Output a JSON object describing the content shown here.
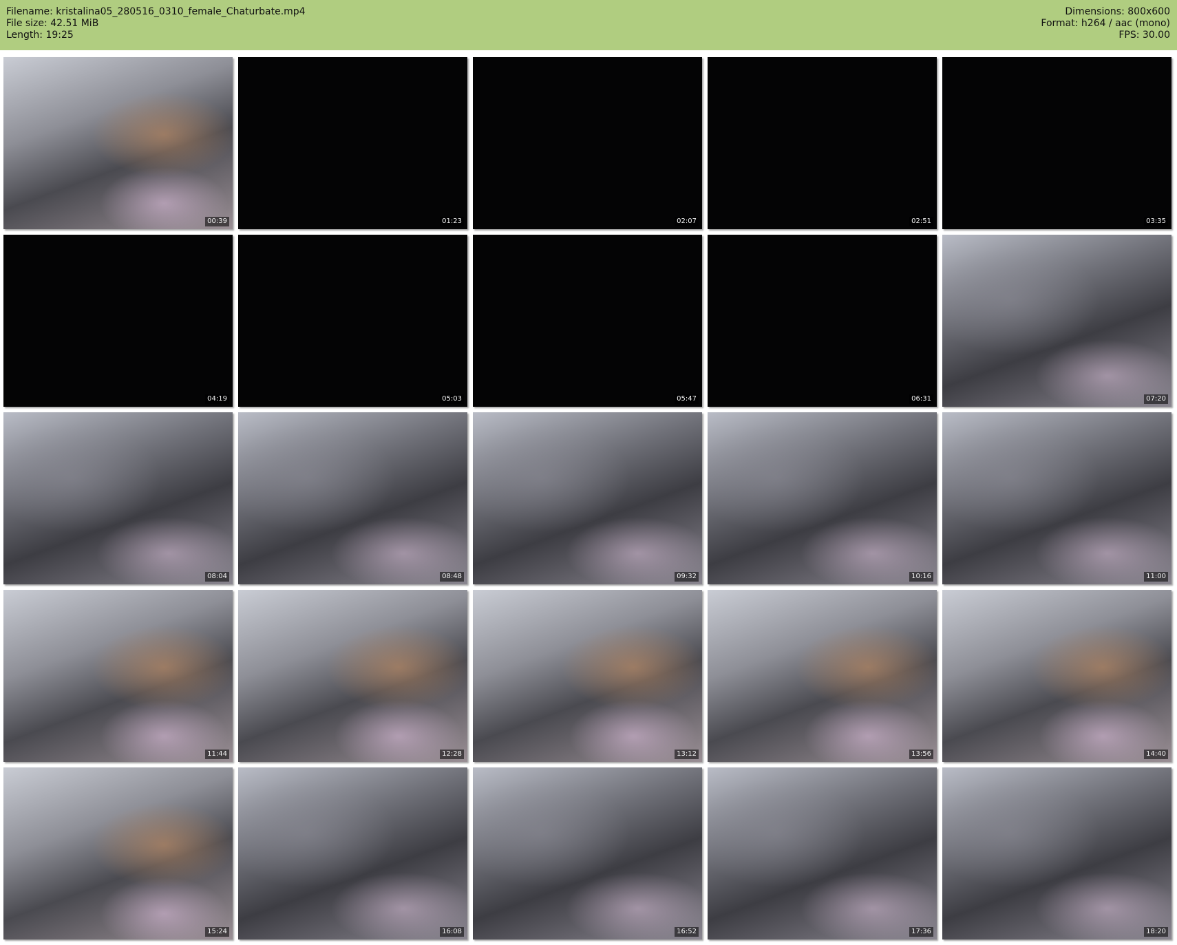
{
  "header": {
    "filename_line": "Filename: kristalina05_280516_0310_female_Chaturbate.mp4",
    "filesize_line": "File size: 42.51 MiB",
    "length_line": "Length: 19:25",
    "dimensions_line": "Dimensions: 800x600",
    "format_line": "Format: h264 / aac (mono)",
    "fps_line": "FPS: 30.00"
  },
  "colors": {
    "header_bg": "#b0cd80",
    "page_bg": "#ffffff"
  },
  "thumbnails": [
    {
      "time": "00:39",
      "kind": "warm"
    },
    {
      "time": "01:23",
      "kind": "dark"
    },
    {
      "time": "02:07",
      "kind": "dark"
    },
    {
      "time": "02:51",
      "kind": "dark"
    },
    {
      "time": "03:35",
      "kind": "dark"
    },
    {
      "time": "04:19",
      "kind": "dark"
    },
    {
      "time": "05:03",
      "kind": "dark"
    },
    {
      "time": "05:47",
      "kind": "dark"
    },
    {
      "time": "06:31",
      "kind": "dark"
    },
    {
      "time": "07:20",
      "kind": "photo"
    },
    {
      "time": "08:04",
      "kind": "photo"
    },
    {
      "time": "08:48",
      "kind": "photo"
    },
    {
      "time": "09:32",
      "kind": "photo"
    },
    {
      "time": "10:16",
      "kind": "photo"
    },
    {
      "time": "11:00",
      "kind": "photo"
    },
    {
      "time": "11:44",
      "kind": "warm"
    },
    {
      "time": "12:28",
      "kind": "warm"
    },
    {
      "time": "13:12",
      "kind": "warm"
    },
    {
      "time": "13:56",
      "kind": "warm"
    },
    {
      "time": "14:40",
      "kind": "warm"
    },
    {
      "time": "15:24",
      "kind": "warm"
    },
    {
      "time": "16:08",
      "kind": "photo"
    },
    {
      "time": "16:52",
      "kind": "photo"
    },
    {
      "time": "17:36",
      "kind": "photo"
    },
    {
      "time": "18:20",
      "kind": "photo"
    }
  ]
}
